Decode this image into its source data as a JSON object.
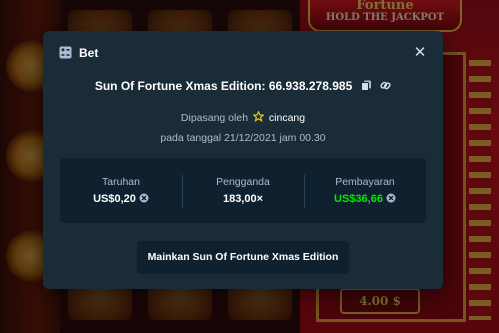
{
  "background": {
    "game_logo_title": "Fortune",
    "game_logo_subtitle": "HOLD THE JACKPOT",
    "prize_value": "4.00 $"
  },
  "modal": {
    "title": "Bet",
    "title_icon": "bet-ticket-icon",
    "close_icon": "close-icon",
    "bet_id_label": "Sun Of Fortune Xmas Edition: 66.938.278.985",
    "placed_by_prefix": "Dipasang oleh",
    "username": "cincang",
    "date_text": "pada tanggal 21/12/2021 jam 00.30",
    "stats": {
      "wager_label": "Taruhan",
      "wager_value": "US$0,20",
      "multiplier_label": "Pengganda",
      "multiplier_value": "183,00×",
      "payout_label": "Pembayaran",
      "payout_value": "US$36,66"
    },
    "play_button_label": "Mainkan Sun Of Fortune Xmas Edition"
  },
  "colors": {
    "modal_bg": "#1a2c38",
    "panel_bg": "#0f212e",
    "payout_green": "#00e701",
    "muted_text": "#b1bad3",
    "star": "#f5d312"
  }
}
